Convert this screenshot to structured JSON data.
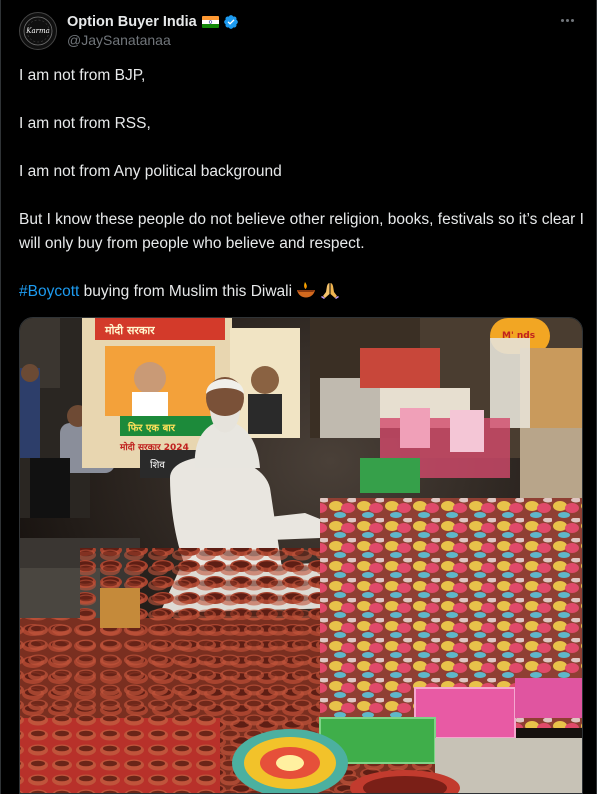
{
  "post": {
    "author": {
      "display_name": "Option Buyer India",
      "handle": "@JaySanatanaa",
      "avatar_text": "Karma",
      "flag_icon": "india-flag-icon",
      "verified_icon": "verified-badge-icon"
    },
    "more_icon": "more-options-icon",
    "paragraphs": [
      "I am not from BJP,",
      "I am not from RSS,",
      "I am not from Any political background",
      "But I know these people do not believe other religion, books, festivals so it’s clear I will only buy from people who believe and respect."
    ],
    "last_line": {
      "hashtag": "#Boycott",
      "text": " buying from Muslim this Diwali",
      "emojis": [
        "diya-lamp-icon",
        "folded-hands-icon"
      ]
    },
    "image": {
      "alt_subject": "photo of a street vendor selling clay diyas",
      "poster_text_1": "मोदी सरकार",
      "poster_text_2": "फिर एक बार",
      "poster_text_3": "मोदी सरकार 2024",
      "poster_text_4": "शिव",
      "sign_text": "M' nds"
    }
  },
  "colors": {
    "background": "#000000",
    "text": "#e7e9ea",
    "secondary": "#71767b",
    "accent": "#1d9bf0"
  }
}
